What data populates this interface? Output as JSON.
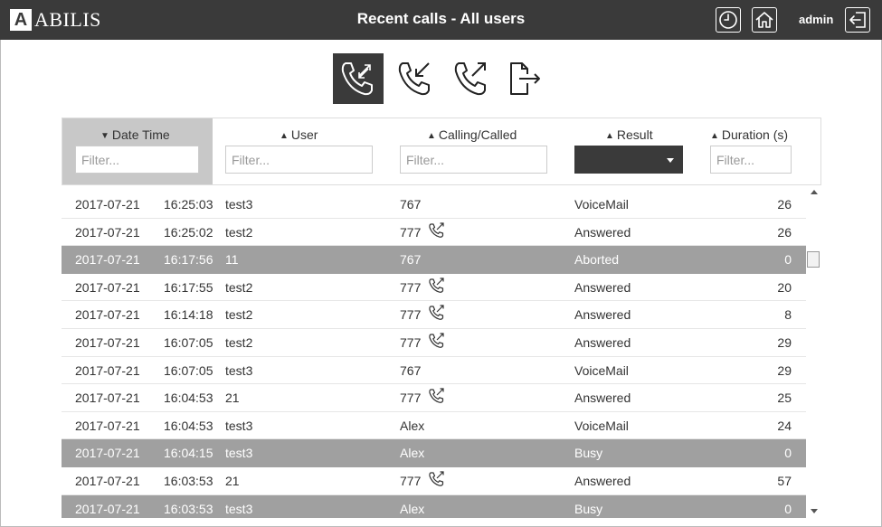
{
  "app": {
    "logo_mark": "A",
    "logo_text": "ABILIS",
    "title": "Recent calls - All users",
    "username": "admin"
  },
  "toolbar": {
    "icons": [
      "all-calls-icon",
      "incoming-calls-icon",
      "outgoing-calls-icon",
      "export-icon"
    ],
    "active": "all-calls"
  },
  "filters": {
    "datetime": {
      "label": "Date Time",
      "sort": "desc",
      "placeholder": "Filter..."
    },
    "user": {
      "label": "User",
      "sort": "none",
      "placeholder": "Filter..."
    },
    "called": {
      "label": "Calling/Called",
      "sort": "none",
      "placeholder": "Filter..."
    },
    "result": {
      "label": "Result",
      "sort": "none",
      "value": ""
    },
    "duration": {
      "label": "Duration (s)",
      "sort": "none",
      "placeholder": "Filter..."
    }
  },
  "colors": {
    "topbar": "#3a3a3a",
    "highlight_row": "#a0a0a0",
    "sorted_column": "#c8c8c8"
  },
  "rows": [
    {
      "date": "2017-07-21",
      "time": "16:25:03",
      "user": "test3",
      "called": "767",
      "forwarded": false,
      "result": "VoiceMail",
      "duration": "26",
      "highlight": false
    },
    {
      "date": "2017-07-21",
      "time": "16:25:02",
      "user": "test2",
      "called": "777",
      "forwarded": true,
      "result": "Answered",
      "duration": "26",
      "highlight": false
    },
    {
      "date": "2017-07-21",
      "time": "16:17:56",
      "user": "11",
      "called": "767",
      "forwarded": false,
      "result": "Aborted",
      "duration": "0",
      "highlight": true
    },
    {
      "date": "2017-07-21",
      "time": "16:17:55",
      "user": "test2",
      "called": "777",
      "forwarded": true,
      "result": "Answered",
      "duration": "20",
      "highlight": false
    },
    {
      "date": "2017-07-21",
      "time": "16:14:18",
      "user": "test2",
      "called": "777",
      "forwarded": true,
      "result": "Answered",
      "duration": "8",
      "highlight": false
    },
    {
      "date": "2017-07-21",
      "time": "16:07:05",
      "user": "test2",
      "called": "777",
      "forwarded": true,
      "result": "Answered",
      "duration": "29",
      "highlight": false
    },
    {
      "date": "2017-07-21",
      "time": "16:07:05",
      "user": "test3",
      "called": "767",
      "forwarded": false,
      "result": "VoiceMail",
      "duration": "29",
      "highlight": false
    },
    {
      "date": "2017-07-21",
      "time": "16:04:53",
      "user": "21",
      "called": "777",
      "forwarded": true,
      "result": "Answered",
      "duration": "25",
      "highlight": false
    },
    {
      "date": "2017-07-21",
      "time": "16:04:53",
      "user": "test3",
      "called": "Alex",
      "forwarded": false,
      "result": "VoiceMail",
      "duration": "24",
      "highlight": false
    },
    {
      "date": "2017-07-21",
      "time": "16:04:15",
      "user": "test3",
      "called": "Alex",
      "forwarded": false,
      "result": "Busy",
      "duration": "0",
      "highlight": true
    },
    {
      "date": "2017-07-21",
      "time": "16:03:53",
      "user": "21",
      "called": "777",
      "forwarded": true,
      "result": "Answered",
      "duration": "57",
      "highlight": false
    },
    {
      "date": "2017-07-21",
      "time": "16:03:53",
      "user": "test3",
      "called": "Alex",
      "forwarded": false,
      "result": "Busy",
      "duration": "0",
      "highlight": true
    }
  ]
}
